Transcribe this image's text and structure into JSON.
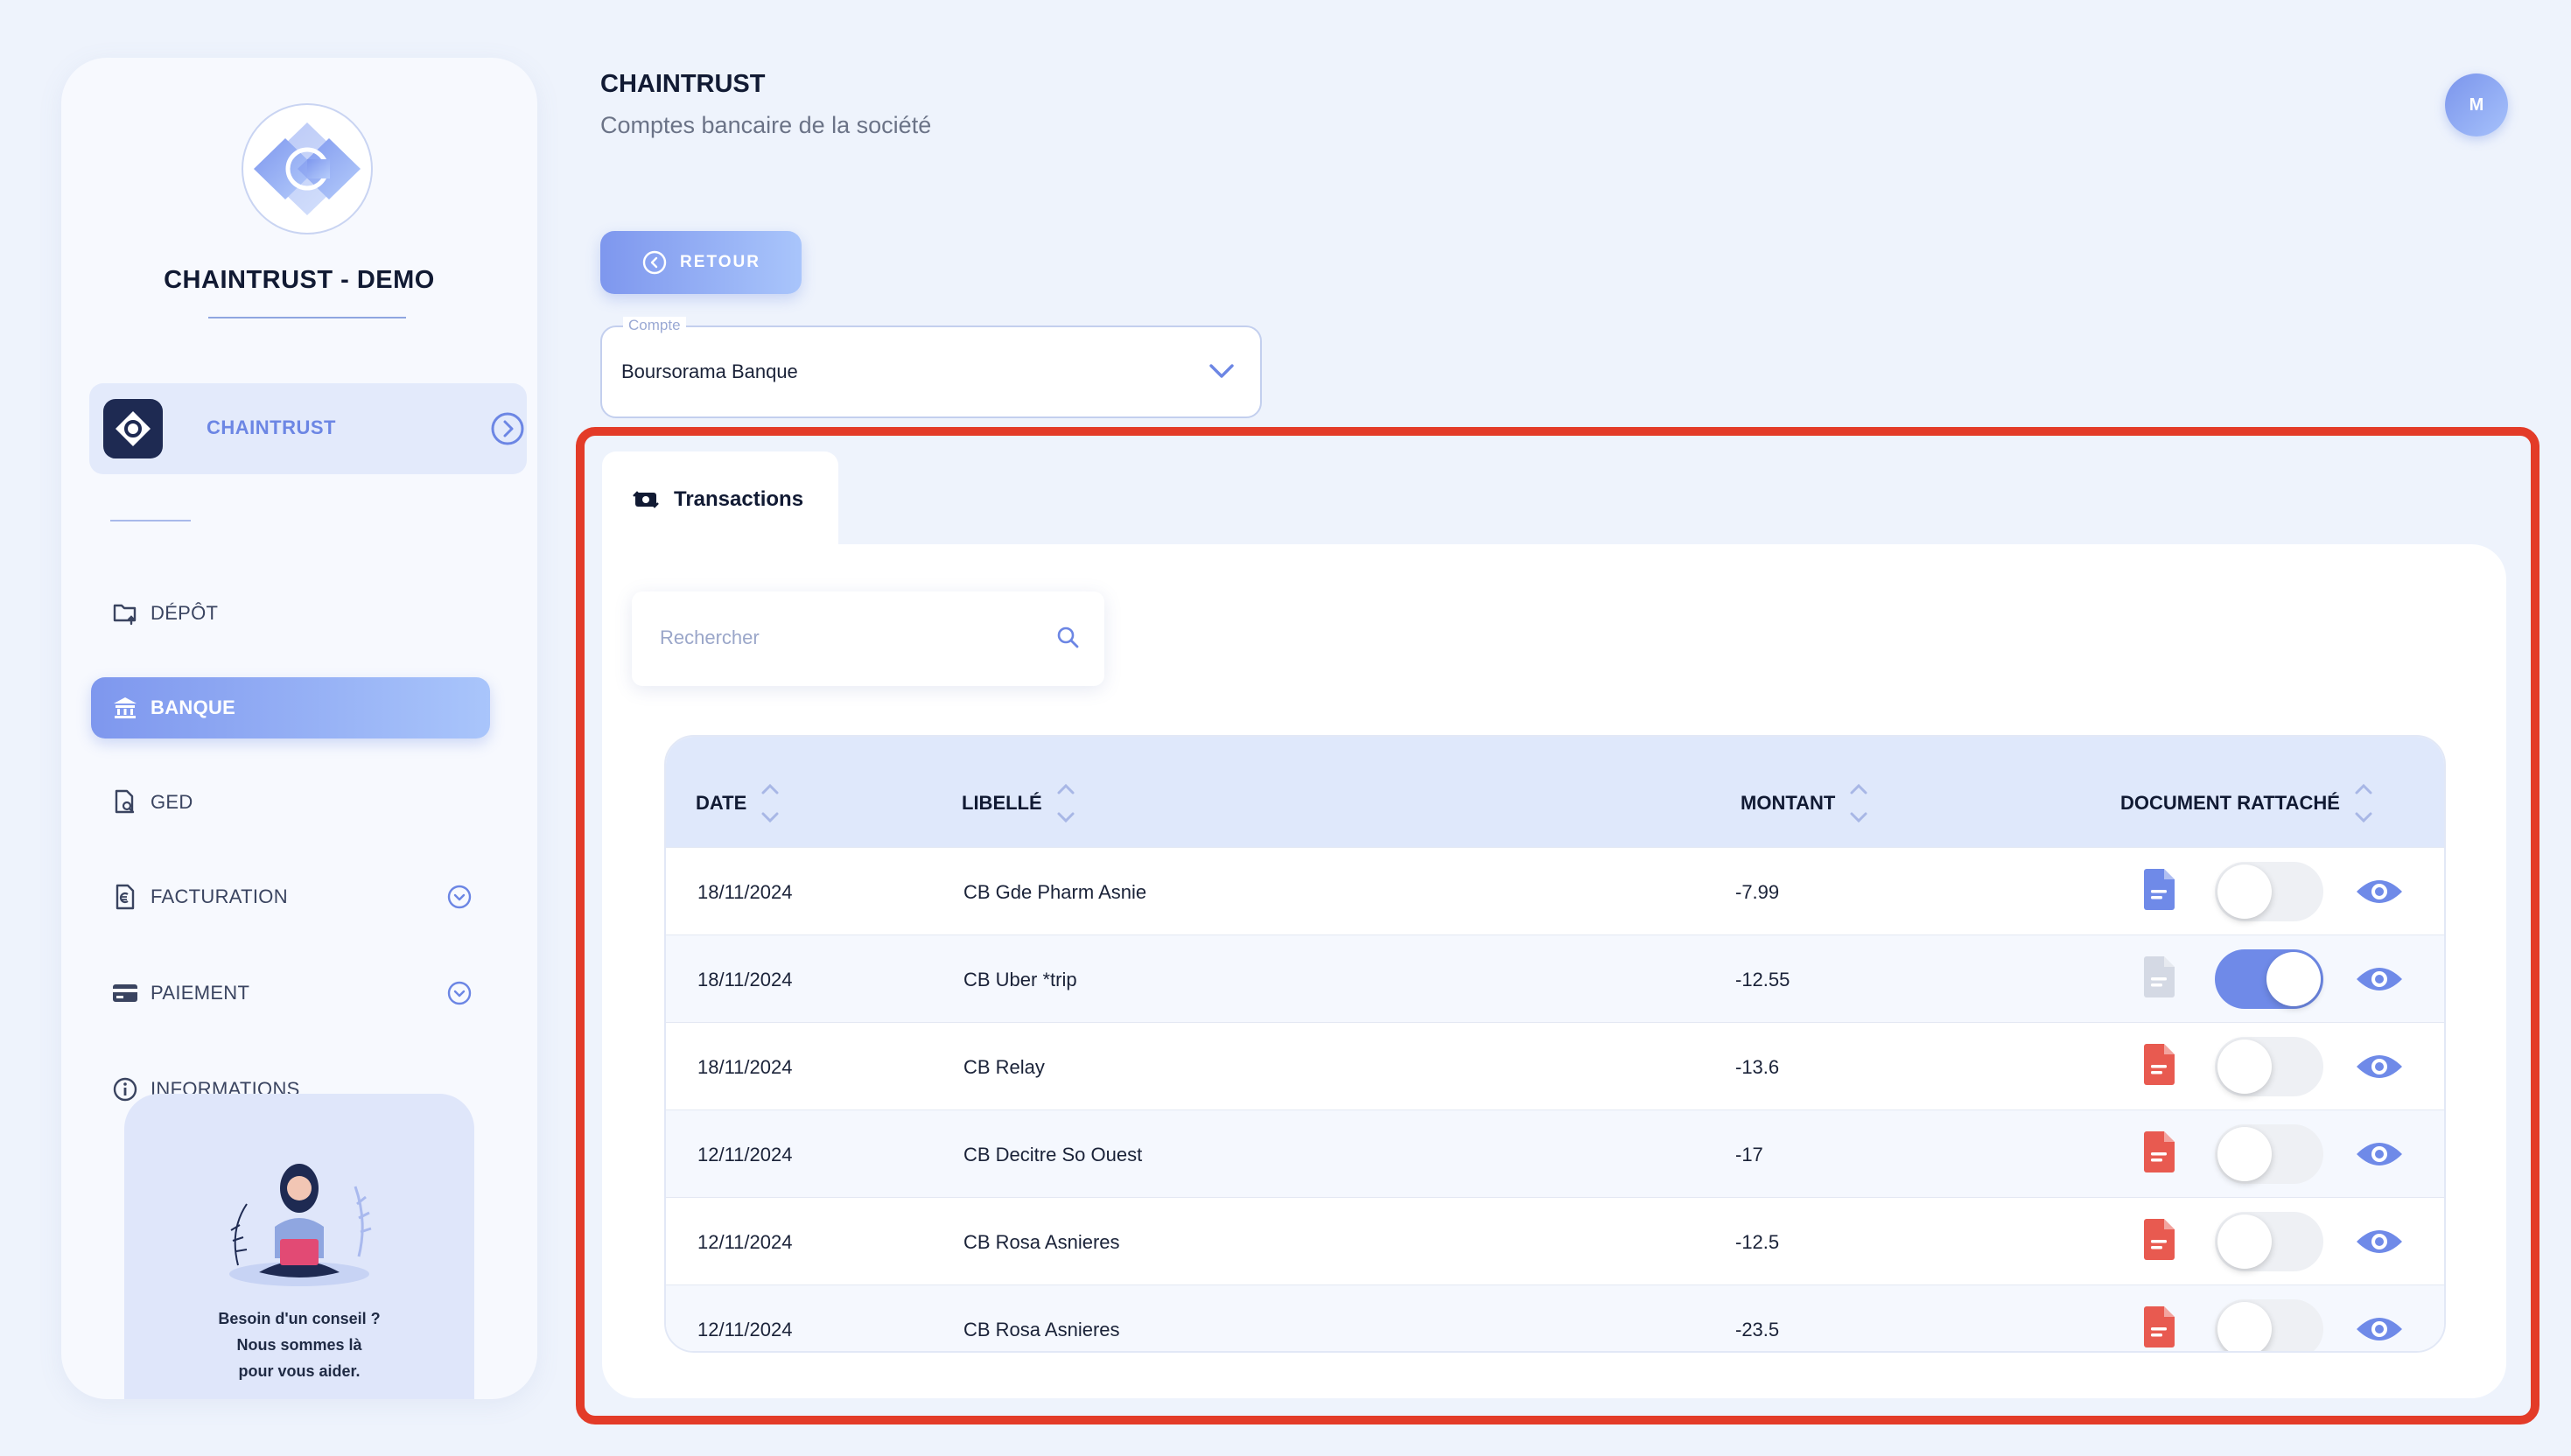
{
  "sidebar": {
    "company_name": "CHAINTRUST - DEMO",
    "company_card_label": "CHAINTRUST",
    "nav": [
      {
        "label": "DÉPÔT",
        "icon": "folder-upload-icon"
      },
      {
        "label": "BANQUE",
        "icon": "bank-icon",
        "active": true
      },
      {
        "label": "GED",
        "icon": "document-search-icon"
      },
      {
        "label": "FACTURATION",
        "icon": "invoice-icon",
        "expandable": true
      },
      {
        "label": "PAIEMENT",
        "icon": "credit-card-icon",
        "expandable": true
      },
      {
        "label": "INFORMATIONS",
        "icon": "info-icon"
      }
    ],
    "help": {
      "line1": "Besoin d'un conseil ?",
      "line2": "Nous sommes là",
      "line3": "pour vous aider."
    }
  },
  "header": {
    "title": "CHAINTRUST",
    "subtitle": "Comptes bancaire de la société",
    "avatar_initial": "M"
  },
  "back_button": {
    "label": "RETOUR"
  },
  "account_select": {
    "legend": "Compte",
    "value": "Boursorama Banque"
  },
  "tab": {
    "label": "Transactions"
  },
  "search": {
    "placeholder": "Rechercher"
  },
  "table": {
    "columns": [
      "DATE",
      "LIBELLÉ",
      "MONTANT",
      "DOCUMENT RATTACHÉ"
    ],
    "rows": [
      {
        "date": "18/11/2024",
        "label": "CB Gde Pharm Asnie",
        "amount": "-7.99",
        "doc_status": "blue",
        "toggle_on": false
      },
      {
        "date": "18/11/2024",
        "label": "CB Uber *trip",
        "amount": "-12.55",
        "doc_status": "grey",
        "toggle_on": true
      },
      {
        "date": "18/11/2024",
        "label": "CB Relay",
        "amount": "-13.6",
        "doc_status": "red",
        "toggle_on": false
      },
      {
        "date": "12/11/2024",
        "label": "CB Decitre So Ouest",
        "amount": "-17",
        "doc_status": "red",
        "toggle_on": false
      },
      {
        "date": "12/11/2024",
        "label": "CB Rosa Asnieres",
        "amount": "-12.5",
        "doc_status": "red",
        "toggle_on": false
      },
      {
        "date": "12/11/2024",
        "label": "CB Rosa Asnieres",
        "amount": "-23.5",
        "doc_status": "red",
        "toggle_on": false
      }
    ]
  },
  "colors": {
    "accent": "#6f8ae8",
    "accent_light": "#a9c5fb",
    "highlight": "#e33b28",
    "doc_blue": "#6f8ae8",
    "doc_red": "#e85a50",
    "doc_grey": "#d4d9e4"
  }
}
